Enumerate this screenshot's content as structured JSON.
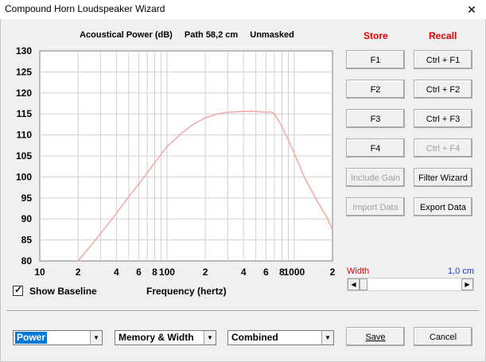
{
  "window": {
    "title": "Compound Horn Loudspeaker Wizard",
    "close_glyph": "✕"
  },
  "chart_header": {
    "quantity": "Acoustical Power (dB)",
    "path": "Path 58,2 cm",
    "mask": "Unmasked"
  },
  "columns": {
    "store": "Store",
    "recall": "Recall"
  },
  "buttons": {
    "f1": "F1",
    "ctrl_f1": "Ctrl + F1",
    "f2": "F2",
    "ctrl_f2": "Ctrl + F2",
    "f3": "F3",
    "ctrl_f3": "Ctrl + F3",
    "f4": "F4",
    "ctrl_f4": "Ctrl + F4",
    "include_gain": "Include Gain",
    "filter_wizard": "Filter Wizard",
    "import_data": "Import Data",
    "export_data": "Export Data",
    "save": "Save",
    "cancel": "Cancel"
  },
  "baseline": {
    "label": "Show Baseline",
    "checked": true,
    "check_glyph": "✓"
  },
  "width": {
    "label": "Width",
    "value": "1,0 cm",
    "slider_position": 0.0
  },
  "dropdowns": {
    "display": "Power",
    "memory": "Memory & Width",
    "mode": "Combined"
  },
  "colors": {
    "curve": "#f4a6a6",
    "accent_red": "#e00000",
    "accent_blue": "#1a3fc0"
  },
  "chart_data": {
    "type": "line",
    "xscale": "log",
    "xlabel": "Frequency (hertz)",
    "xlim": [
      10,
      2000
    ],
    "ylim": [
      80,
      130
    ],
    "y_ticks": [
      "130",
      "125",
      "120",
      "115",
      "110",
      "105",
      "100",
      "95",
      "90",
      "85",
      "80"
    ],
    "y_tick_values": [
      130,
      125,
      120,
      115,
      110,
      105,
      100,
      95,
      90,
      85,
      80
    ],
    "x_ticks": [
      "10",
      "2",
      "4",
      "6",
      "8",
      "100",
      "2",
      "4",
      "6",
      "8",
      "1000",
      "2"
    ],
    "x_tick_values": [
      10,
      20,
      40,
      60,
      80,
      100,
      200,
      400,
      600,
      800,
      1000,
      2000
    ],
    "grid": true,
    "series": [
      {
        "x": [
          20,
          25,
          30,
          40,
          50,
          60,
          70,
          80,
          100,
          130,
          160,
          200,
          250,
          300,
          400,
          500,
          600,
          650,
          700,
          800,
          900,
          1000,
          1200,
          1500,
          1800,
          2000
        ],
        "y": [
          80,
          83.5,
          86.5,
          91.3,
          95.3,
          98.3,
          101,
          103.4,
          107.2,
          110.4,
          112.5,
          114.1,
          115.0,
          115.4,
          115.6,
          115.6,
          115.4,
          115.5,
          115.0,
          112.0,
          108.8,
          105.6,
          100.0,
          94.5,
          90.5,
          87.5
        ]
      }
    ]
  }
}
